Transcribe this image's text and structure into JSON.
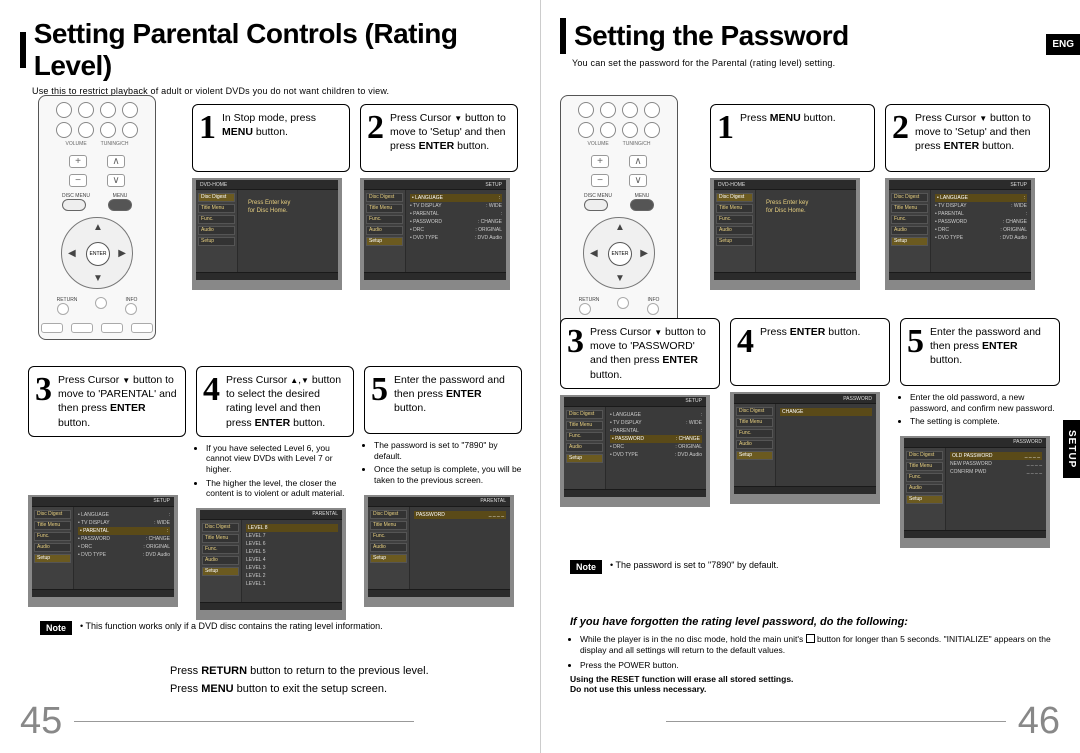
{
  "badges": {
    "lang": "ENG",
    "setup_tab": "SETUP"
  },
  "left": {
    "title": "Setting Parental Controls (Rating Level)",
    "subtitle": "Use this to restrict playback of adult or violent DVDs you do not want children to view.",
    "step1": "In Stop mode, press <b>MENU</b> button.",
    "step2": "Press Cursor <span class='tri-down'></span> button to move to 'Setup' and then press <b>ENTER</b> button.",
    "step3": "Press Cursor <span class='tri-down'></span> button to move to 'PARENTAL' and then press <b>ENTER</b> button.",
    "step4": "Press Cursor <span class='tri-up'></span>,<span class='tri-down'></span> button to select the desired rating level and then press <b>ENTER</b> button.",
    "step4_notes": [
      "If you have selected Level 6, you cannot view DVDs with Level 7 or higher.",
      "The higher the level, the closer the content is to violent or adult material."
    ],
    "step5": "Enter the password and then press <b>ENTER</b> button.",
    "step5_notes": [
      "The password is set to \"7890\" by default.",
      "Once the setup is complete, you will be taken to the previous screen."
    ],
    "note_label": "Note",
    "note_text": "• This function works only if a DVD disc contains the rating level information.",
    "footer1": "Press <b>RETURN</b> button to return to the previous level.",
    "footer2": "Press <b>MENU</b> button to exit the setup screen.",
    "pagenum": "45"
  },
  "right": {
    "title": "Setting the Password",
    "subtitle": "You can set the password for the Parental (rating level) setting.",
    "step1": "Press <b>MENU</b> button.",
    "step2": "Press Cursor <span class='tri-down'></span> button to move to 'Setup' and then press <b>ENTER</b> button.",
    "step3": "Press Cursor <span class='tri-down'></span> button to move to 'PASSWORD' and then press <b>ENTER</b> button.",
    "step4": "Press <b>ENTER</b> button.",
    "step5": "Enter the password and then press <b>ENTER</b> button.",
    "step5_notes": [
      "Enter the old password, a new password, and confirm new password.",
      "The setting is complete."
    ],
    "note_label": "Note",
    "note_text": "• The password is set to \"7890\" by default.",
    "forgot_title": "If you have forgotten the rating level password, do the following:",
    "forgot_items": [
      "While the player is in the no disc mode, hold the main unit's <span class='stop-sym'></span> button for longer than 5 seconds. \"INITIALIZE\" appears on the display and all settings will return to the default values.",
      "Press the POWER button."
    ],
    "forgot_bold1": "Using the RESET function will erase all stored settings.",
    "forgot_bold2": "Do not use this unless necessary.",
    "pagenum": "46"
  },
  "tv": {
    "side": [
      "Disc Digest",
      "Title Menu",
      "Func.",
      "Audio",
      "Setup"
    ],
    "menu_rows": [
      {
        "l": "LANGUAGE",
        "r": ""
      },
      {
        "l": "TV DISPLAY",
        "r": "WIDE"
      },
      {
        "l": "PARENTAL",
        "r": ""
      },
      {
        "l": "PASSWORD",
        "r": "CHANGE"
      },
      {
        "l": "DRC",
        "r": "ORIGINAL"
      },
      {
        "l": "DVD TYPE",
        "r": "DVD Audio"
      }
    ],
    "hint": "Press Enter key\\nfor Disc Home.",
    "parental_levels": [
      "LEVEL 8",
      "LEVEL 7",
      "LEVEL 6",
      "LEVEL 5",
      "LEVEL 4",
      "LEVEL 3",
      "LEVEL 2",
      "LEVEL 1"
    ],
    "pw_rows": [
      "OLD PASSWORD",
      "NEW PASSWORD",
      "CONFIRM PWD"
    ],
    "header_l": "DVD-HOME",
    "header_r": "SETUP"
  }
}
